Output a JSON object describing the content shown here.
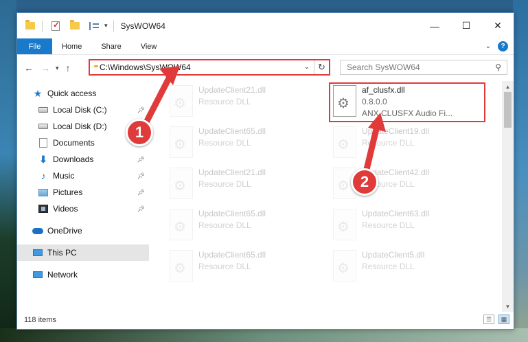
{
  "window": {
    "title": "SysWOW64",
    "controls": {
      "minimize": "—",
      "maximize": "☐",
      "close": "✕"
    }
  },
  "ribbon": {
    "tabs": [
      "File",
      "Home",
      "Share",
      "View"
    ],
    "help": "?"
  },
  "address": {
    "path": "C:\\Windows\\SysWOW64",
    "search_placeholder": "Search SysWOW64"
  },
  "nav": {
    "items": [
      {
        "label": "Quick access",
        "icon": "star-icon",
        "pinned": false
      },
      {
        "label": "Local Disk (C:)",
        "icon": "disk-icon",
        "pinned": true
      },
      {
        "label": "Local Disk (D:)",
        "icon": "disk-icon",
        "pinned": false
      },
      {
        "label": "Documents",
        "icon": "documents-icon",
        "pinned": true
      },
      {
        "label": "Downloads",
        "icon": "downloads-icon",
        "pinned": true
      },
      {
        "label": "Music",
        "icon": "music-icon",
        "pinned": true
      },
      {
        "label": "Pictures",
        "icon": "pictures-icon",
        "pinned": true
      },
      {
        "label": "Videos",
        "icon": "videos-icon",
        "pinned": true
      },
      {
        "label": "OneDrive",
        "icon": "onedrive-icon",
        "pinned": false
      },
      {
        "label": "This PC",
        "icon": "this-pc-icon",
        "pinned": false,
        "selected": true
      },
      {
        "label": "Network",
        "icon": "network-icon",
        "pinned": false
      }
    ]
  },
  "files": {
    "highlighted": {
      "name": "af_clusfx.dll",
      "version": "0.8.0.0",
      "description": "ANX CLUSFX Audio Fi..."
    },
    "left_column": [
      {
        "name": "UpdateClient21.dll",
        "type": "Resource DLL"
      },
      {
        "name": "UpdateClient65.dll",
        "type": "Resource DLL"
      },
      {
        "name": "UpdateClient21.dll",
        "type": "Resource DLL"
      },
      {
        "name": "UpdateClient65.dll",
        "type": "Resource DLL"
      },
      {
        "name": "UpdateClient65.dll",
        "type": "Resource DLL"
      }
    ],
    "right_column": [
      {
        "name": "UpdateClient19.dll",
        "type": "Resource DLL"
      },
      {
        "name": "UpdateClient42.dll",
        "type": "Resource DLL"
      },
      {
        "name": "UpdateClient63.dll",
        "type": "Resource DLL"
      },
      {
        "name": "UpdateClient5.dll",
        "type": "Resource DLL"
      }
    ]
  },
  "status": {
    "item_count": "118 items"
  },
  "callouts": {
    "one": "1",
    "two": "2"
  },
  "colors": {
    "accent": "#1979ca",
    "highlight_red": "#e03a3a"
  }
}
